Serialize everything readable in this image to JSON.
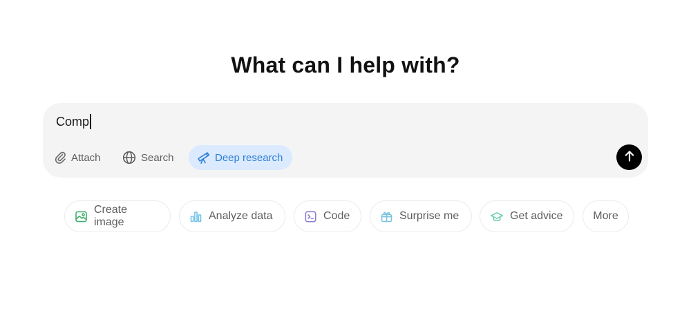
{
  "heading": "What can I help with?",
  "composer": {
    "input_value": "Comp",
    "tools": {
      "attach": "Attach",
      "search": "Search",
      "deep_research": "Deep research"
    },
    "send_icon": "arrow-up-icon"
  },
  "suggestions": [
    {
      "label": "Create image",
      "icon": "image-icon",
      "color": "#3fae6a"
    },
    {
      "label": "Analyze data",
      "icon": "bar-chart-icon",
      "color": "#6fc3e6"
    },
    {
      "label": "Code",
      "icon": "terminal-icon",
      "color": "#8f7fd1"
    },
    {
      "label": "Surprise me",
      "icon": "gift-icon",
      "color": "#7cc3dd"
    },
    {
      "label": "Get advice",
      "icon": "graduation-cap-icon",
      "color": "#6fcfb6"
    },
    {
      "label": "More",
      "icon": "",
      "color": ""
    }
  ],
  "colors": {
    "composer_bg": "#f4f4f4",
    "deep_research_bg": "#dbeafe",
    "deep_research_text": "#2f7fd6",
    "send_button": "#000000"
  }
}
